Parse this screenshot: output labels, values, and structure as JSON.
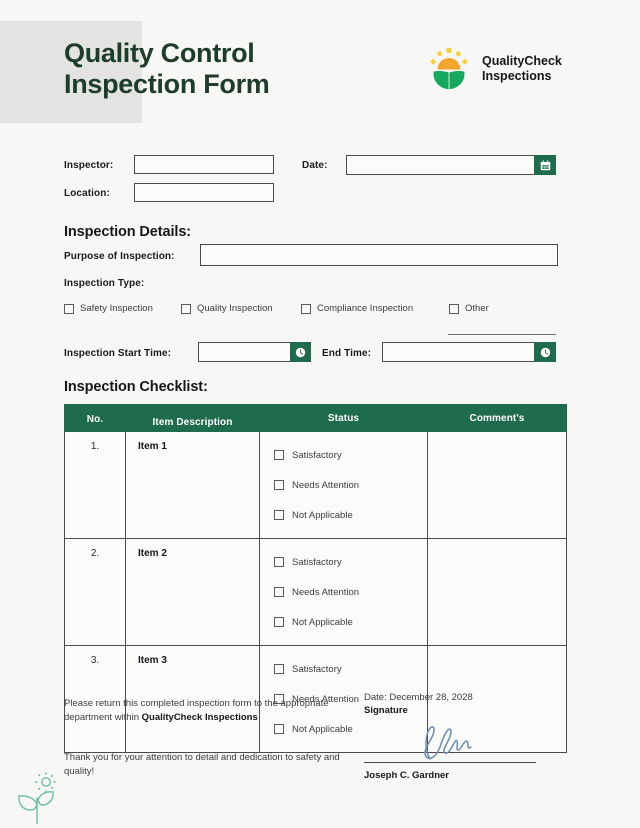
{
  "document": {
    "title": "Quality Control\nInspection Form",
    "background_color": "#f7f7f5",
    "accent_green": "#1e6b4e",
    "title_color": "#1e3d28",
    "header_block_color": "#e3e4e2"
  },
  "brand": {
    "logo_icon": "sun-over-leaves-logo-icon",
    "name": "QualityCheck\nInspections",
    "sun_color": "#f2a62e",
    "ray_color": "#f5cf3b",
    "leaf_color": "#16a95c"
  },
  "top_fields": {
    "inspector": {
      "label": "Inspector:",
      "value": "",
      "placeholder": ""
    },
    "location": {
      "label": "Location:",
      "value": "",
      "placeholder": ""
    },
    "date": {
      "label": "Date:",
      "value": "",
      "placeholder": "",
      "icon": "calendar-icon"
    }
  },
  "inspection_details": {
    "heading": "Inspection Details:",
    "purpose": {
      "label": "Purpose of Inspection:",
      "value": "",
      "placeholder": ""
    },
    "type_label": "Inspection Type:",
    "types": [
      {
        "label": "Safety Inspection",
        "checked": false
      },
      {
        "label": "Quality Inspection",
        "checked": false
      },
      {
        "label": "Compliance Inspection",
        "checked": false
      },
      {
        "label": "Other",
        "checked": false
      }
    ],
    "other_write_in": "",
    "start_time": {
      "label": "Inspection Start Time:",
      "value": "",
      "placeholder": "",
      "icon": "clock-icon"
    },
    "end_time": {
      "label": "End Time:",
      "value": "",
      "placeholder": "",
      "icon": "clock-icon"
    }
  },
  "checklist": {
    "heading": "Inspection Checklist:",
    "columns": [
      "No.",
      "Item Description",
      "Status",
      "Comment's"
    ],
    "status_options": [
      "Satisfactory",
      "Needs Attention",
      "Not Applicable"
    ],
    "rows": [
      {
        "no": "1.",
        "description": "Item 1",
        "comment": ""
      },
      {
        "no": "2.",
        "description": "Item 2",
        "comment": ""
      },
      {
        "no": "3.",
        "description": "Item 3",
        "comment": ""
      }
    ]
  },
  "footer": {
    "return_note_prefix": "Please return this completed inspection form to the appropriate department within ",
    "return_note_brand": "QualityCheck Inspections",
    "thanks": "Thank you for your attention to detail and dedication to safety and quality!",
    "signature_date": "Date: December 28, 2028",
    "signature_label": "Signature",
    "signature_name": "Joseph C. Gardner",
    "signature_ink_color": "#6a8cb5",
    "decoration_icon": "sprout-plant-icon",
    "decoration_color": "#6bbda8"
  }
}
